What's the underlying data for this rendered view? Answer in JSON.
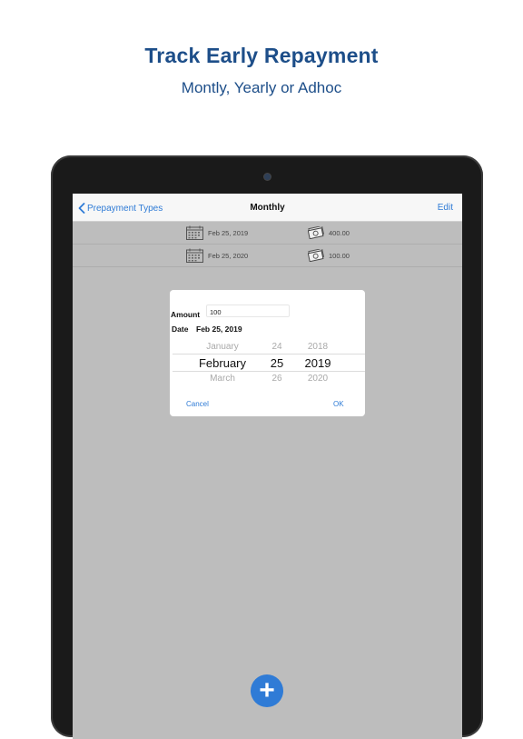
{
  "header": {
    "title": "Track Early Repayment",
    "subtitle": "Montly, Yearly or Adhoc"
  },
  "navbar": {
    "back_label": "Prepayment Types",
    "title": "Monthly",
    "edit_label": "Edit"
  },
  "rows": [
    {
      "date": "Feb 25, 2019",
      "amount": "400.00"
    },
    {
      "date": "Feb 25, 2020",
      "amount": "100.00"
    }
  ],
  "dialog": {
    "amount_label": "Amount",
    "amount_value": "100",
    "date_label": "Date",
    "date_value": "Feb 25, 2019",
    "picker": {
      "month_prev": "January",
      "month_sel": "February",
      "month_next": "March",
      "day_prev": "24",
      "day_sel": "25",
      "day_next": "26",
      "year_prev": "2018",
      "year_sel": "2019",
      "year_next": "2020"
    },
    "cancel_label": "Cancel",
    "ok_label": "OK"
  },
  "fab": {
    "symbol": "+"
  },
  "colors": {
    "accent": "#2f7bd6",
    "headline": "#1d4e89",
    "screen_bg": "#bdbdbd"
  }
}
